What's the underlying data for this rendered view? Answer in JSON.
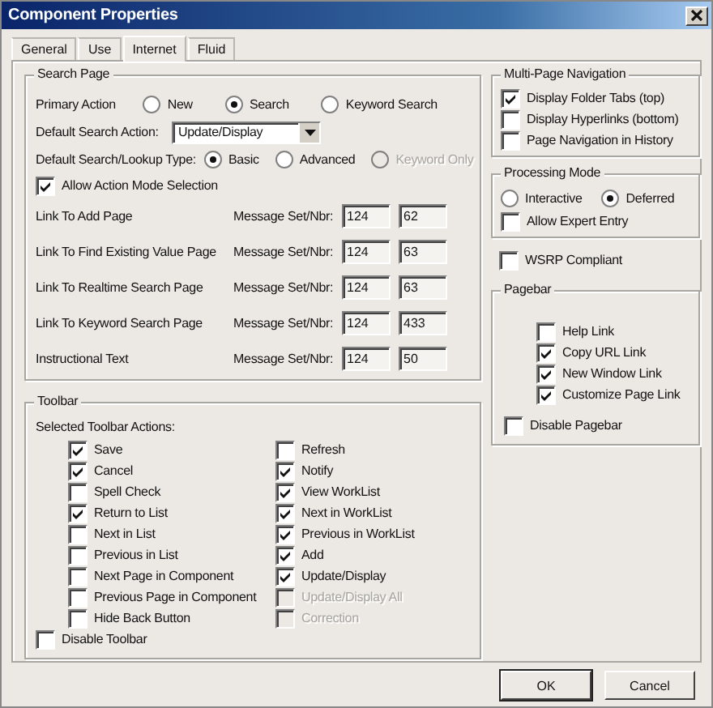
{
  "window": {
    "title": "Component Properties"
  },
  "tabs": [
    {
      "label": "General",
      "selected": false
    },
    {
      "label": "Use",
      "selected": false
    },
    {
      "label": "Internet",
      "selected": true
    },
    {
      "label": "Fluid",
      "selected": false
    }
  ],
  "search_page": {
    "title": "Search Page",
    "primary_action": {
      "label": "Primary Action",
      "options": [
        {
          "label": "New",
          "selected": false
        },
        {
          "label": "Search",
          "selected": true
        },
        {
          "label": "Keyword Search",
          "selected": false
        }
      ]
    },
    "default_search_action": {
      "label": "Default Search Action:",
      "value": "Update/Display"
    },
    "lookup_type": {
      "label": "Default Search/Lookup Type:",
      "options": [
        {
          "label": "Basic",
          "selected": true,
          "disabled": false
        },
        {
          "label": "Advanced",
          "selected": false,
          "disabled": false
        },
        {
          "label": "Keyword Only",
          "selected": false,
          "disabled": true
        }
      ]
    },
    "allow_action_mode": {
      "label": "Allow Action Mode Selection",
      "checked": true
    },
    "links": [
      {
        "label": "Link To Add Page",
        "field_label": "Message Set/Nbr:",
        "set": "124",
        "number": "62"
      },
      {
        "label": "Link To Find Existing Value Page",
        "field_label": "Message Set/Nbr:",
        "set": "124",
        "number": "63"
      },
      {
        "label": "Link To Realtime Search Page",
        "field_label": "Message Set/Nbr:",
        "set": "124",
        "number": "63"
      },
      {
        "label": "Link To Keyword Search Page",
        "field_label": "Message Set/Nbr:",
        "set": "124",
        "number": "433"
      },
      {
        "label": "Instructional Text",
        "field_label": "Message Set/Nbr:",
        "set": "124",
        "number": "50"
      }
    ]
  },
  "toolbar": {
    "title": "Toolbar",
    "subtitle": "Selected Toolbar Actions:",
    "columns": [
      [
        {
          "label": "Save",
          "checked": true,
          "disabled": false
        },
        {
          "label": "Cancel",
          "checked": true,
          "disabled": false
        },
        {
          "label": "Spell Check",
          "checked": false,
          "disabled": false
        },
        {
          "label": "Return to List",
          "checked": true,
          "disabled": false
        },
        {
          "label": "Next in List",
          "checked": false,
          "disabled": false
        },
        {
          "label": "Previous in List",
          "checked": false,
          "disabled": false
        },
        {
          "label": "Next Page in Component",
          "checked": false,
          "disabled": false
        },
        {
          "label": "Previous Page in Component",
          "checked": false,
          "disabled": false
        },
        {
          "label": "Hide Back Button",
          "checked": false,
          "disabled": false
        }
      ],
      [
        {
          "label": "Refresh",
          "checked": false,
          "disabled": false
        },
        {
          "label": "Notify",
          "checked": true,
          "disabled": false
        },
        {
          "label": "View WorkList",
          "checked": true,
          "disabled": false
        },
        {
          "label": "Next in WorkList",
          "checked": true,
          "disabled": false
        },
        {
          "label": "Previous in WorkList",
          "checked": true,
          "disabled": false
        },
        {
          "label": "Add",
          "checked": true,
          "disabled": false
        },
        {
          "label": "Update/Display",
          "checked": true,
          "disabled": false
        },
        {
          "label": "Update/Display All",
          "checked": false,
          "disabled": true
        },
        {
          "label": "Correction",
          "checked": false,
          "disabled": true
        }
      ]
    ],
    "disable": {
      "label": "Disable Toolbar",
      "checked": false
    }
  },
  "multi_page_navigation": {
    "title": "Multi-Page Navigation",
    "items": [
      {
        "label": "Display Folder Tabs (top)",
        "checked": true
      },
      {
        "label": "Display Hyperlinks (bottom)",
        "checked": false
      },
      {
        "label": "Page Navigation in History",
        "checked": false
      }
    ]
  },
  "processing_mode": {
    "title": "Processing Mode",
    "options": [
      {
        "label": "Interactive",
        "selected": false
      },
      {
        "label": "Deferred",
        "selected": true
      }
    ],
    "allow_expert_entry": {
      "label": "Allow Expert Entry",
      "checked": false
    }
  },
  "wsrp_compliant": {
    "label": "WSRP Compliant",
    "checked": false
  },
  "pagebar": {
    "title": "Pagebar",
    "items": [
      {
        "label": "Help Link",
        "checked": false
      },
      {
        "label": "Copy URL Link",
        "checked": true
      },
      {
        "label": "New Window Link",
        "checked": true
      },
      {
        "label": "Customize Page Link",
        "checked": true
      }
    ],
    "disable": {
      "label": "Disable Pagebar",
      "checked": false
    }
  },
  "buttons": [
    {
      "label": "OK",
      "default": true
    },
    {
      "label": "Cancel",
      "default": false
    }
  ]
}
